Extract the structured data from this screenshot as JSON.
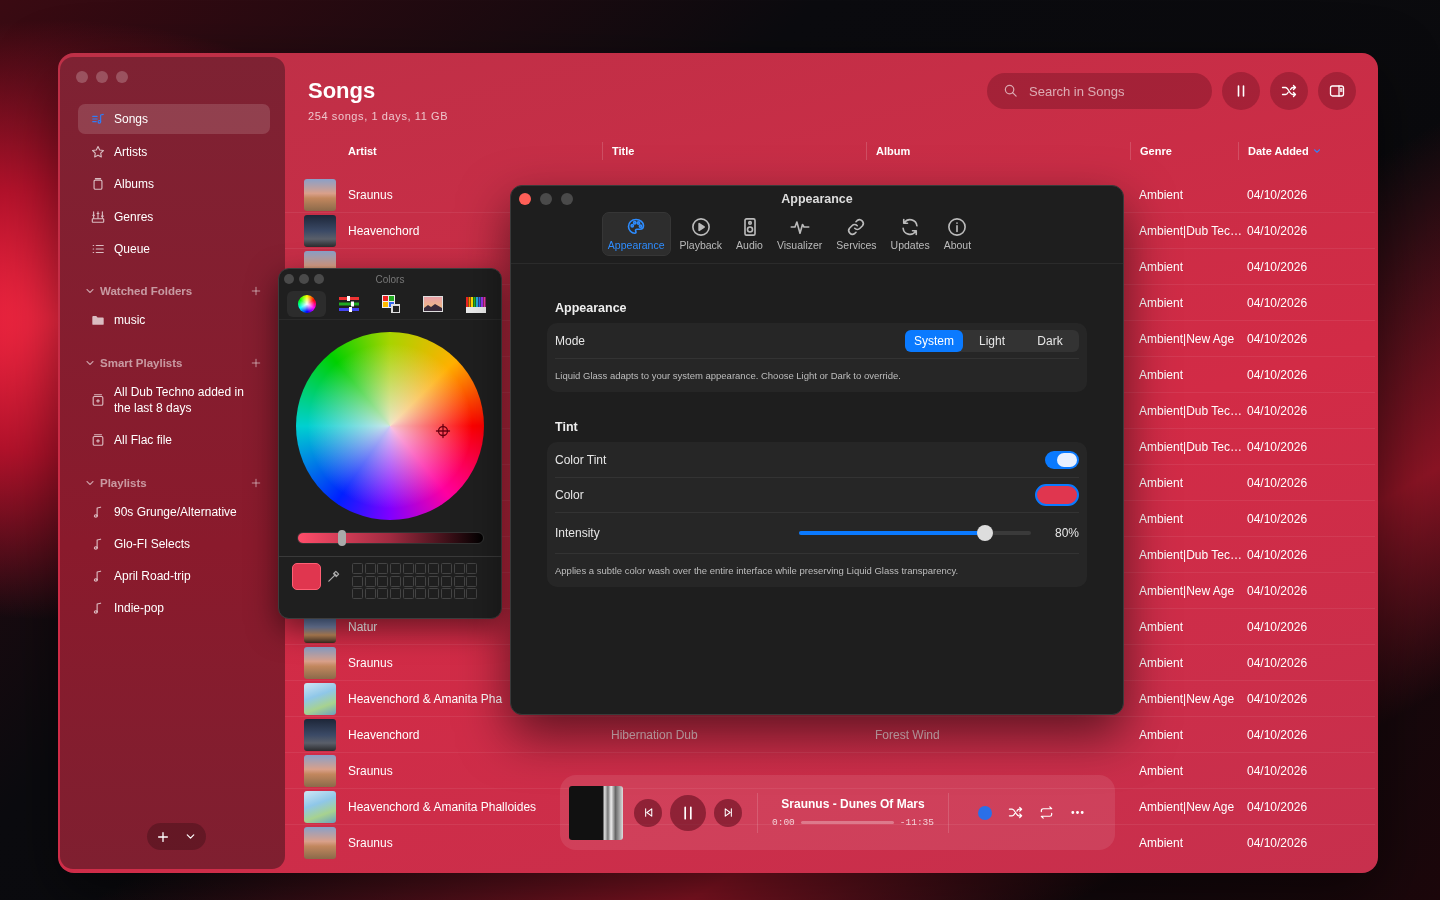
{
  "sidebar": {
    "nav": [
      {
        "label": "Songs",
        "selected": true
      },
      {
        "label": "Artists",
        "selected": false
      },
      {
        "label": "Albums",
        "selected": false
      },
      {
        "label": "Genres",
        "selected": false
      },
      {
        "label": "Queue",
        "selected": false
      }
    ],
    "sections": [
      {
        "title": "Watched Folders",
        "expanded": true,
        "items": [
          {
            "label": "music",
            "kind": "folder"
          }
        ]
      },
      {
        "title": "Smart Playlists",
        "expanded": true,
        "items": [
          {
            "label": "All Dub Techno added in the last 8 days",
            "kind": "smart"
          },
          {
            "label": "All Flac file",
            "kind": "smart"
          }
        ]
      },
      {
        "title": "Playlists",
        "expanded": true,
        "items": [
          {
            "label": "90s Grunge/Alternative",
            "kind": "playlist"
          },
          {
            "label": "Glo-FI Selects",
            "kind": "playlist"
          },
          {
            "label": "April Road-trip",
            "kind": "playlist"
          },
          {
            "label": "Indie-pop",
            "kind": "playlist"
          }
        ]
      }
    ]
  },
  "header": {
    "title": "Songs",
    "subtitle": "254 songs, 1 days, 11 GB",
    "search": {
      "placeholder": "Search in Songs"
    }
  },
  "table": {
    "columns": [
      {
        "label": "Artist"
      },
      {
        "label": "Title"
      },
      {
        "label": "Album"
      },
      {
        "label": "Genre"
      },
      {
        "label": "Date Added",
        "sorted": true
      }
    ],
    "rows": [
      {
        "kind": "figure",
        "artist": "Sraunus",
        "genre": "Ambient",
        "date_added": "04/10/2026"
      },
      {
        "kind": "night",
        "artist": "Heavenchord",
        "genre": "Ambient|Dub Tec…",
        "date_added": "04/10/2026"
      },
      {
        "kind": "figure",
        "genre": "Ambient",
        "date_added": "04/10/2026"
      },
      {
        "genre": "Ambient",
        "date_added": "04/10/2026"
      },
      {
        "genre": "Ambient|New Age",
        "date_added": "04/10/2026"
      },
      {
        "genre": "Ambient",
        "date_added": "04/10/2026"
      },
      {
        "genre": "Ambient|Dub Tec…",
        "date_added": "04/10/2026"
      },
      {
        "genre": "Ambient|Dub Tec…",
        "date_added": "04/10/2026"
      },
      {
        "genre": "Ambient",
        "date_added": "04/10/2026"
      },
      {
        "genre": "Ambient",
        "date_added": "04/10/2026"
      },
      {
        "genre": "Ambient|Dub Tec…",
        "date_added": "04/10/2026"
      },
      {
        "genre": "Ambient|New Age",
        "date_added": "04/10/2026"
      },
      {
        "kind": "dusk",
        "artist": "Natur",
        "genre": "Ambient",
        "date_added": "04/10/2026"
      },
      {
        "kind": "figure",
        "artist": "Sraunus",
        "genre": "Ambient",
        "date_added": "04/10/2026"
      },
      {
        "kind": "bright",
        "artist": "Heavenchord & Amanita Pha",
        "genre": "Ambient|New Age",
        "date_added": "04/10/2026"
      },
      {
        "kind": "night",
        "artist": "Heavenchord",
        "title": "Hibernation Dub",
        "album": "Forest Wind",
        "genre": "Ambient",
        "date_added": "04/10/2026"
      },
      {
        "kind": "figure",
        "artist": "Sraunus",
        "genre": "Ambient",
        "date_added": "04/10/2026"
      },
      {
        "kind": "bright",
        "artist": "Heavenchord & Amanita Phalloides",
        "genre": "Ambient|New Age",
        "date_added": "04/10/2026"
      },
      {
        "kind": "figure",
        "artist": "Sraunus",
        "genre": "Ambient",
        "date_added": "04/10/2026"
      }
    ]
  },
  "colors_panel": {
    "title": "Colors",
    "modes": [
      {
        "selected": true
      },
      {
        "selected": false
      },
      {
        "selected": false
      },
      {
        "selected": false
      },
      {
        "selected": false
      }
    ],
    "brightness": {
      "level": 0.24
    }
  },
  "preferences": {
    "title": "Appearance",
    "tabs": [
      {
        "label": "Appearance",
        "selected": true
      },
      {
        "label": "Playback",
        "selected": false
      },
      {
        "label": "Audio",
        "selected": false
      },
      {
        "label": "Visualizer",
        "selected": false
      },
      {
        "label": "Services",
        "selected": false
      },
      {
        "label": "Updates",
        "selected": false
      },
      {
        "label": "About",
        "selected": false
      }
    ],
    "sections": [
      {
        "title": "Appearance",
        "rows": [
          {
            "kind": "segmented",
            "label": "Mode",
            "options": [
              {
                "label": "System",
                "selected": true
              },
              {
                "label": "Light",
                "selected": false
              },
              {
                "label": "Dark",
                "selected": false
              }
            ]
          }
        ],
        "note": "Liquid Glass adapts to your system appearance. Choose Light or Dark to override."
      },
      {
        "title": "Tint",
        "rows": [
          {
            "kind": "toggle",
            "label": "Color Tint",
            "on": true
          },
          {
            "kind": "color",
            "label": "Color"
          },
          {
            "kind": "slider",
            "label": "Intensity",
            "level": 0.8,
            "reading": "80%"
          }
        ],
        "note": "Applies a subtle color wash over the entire interface while preserving Liquid Glass transparency."
      }
    ]
  },
  "player": {
    "track": "Sraunus - Dunes Of Mars",
    "elapsed": "0:00",
    "remaining": "-11:35",
    "level": 0,
    "playing": true
  }
}
